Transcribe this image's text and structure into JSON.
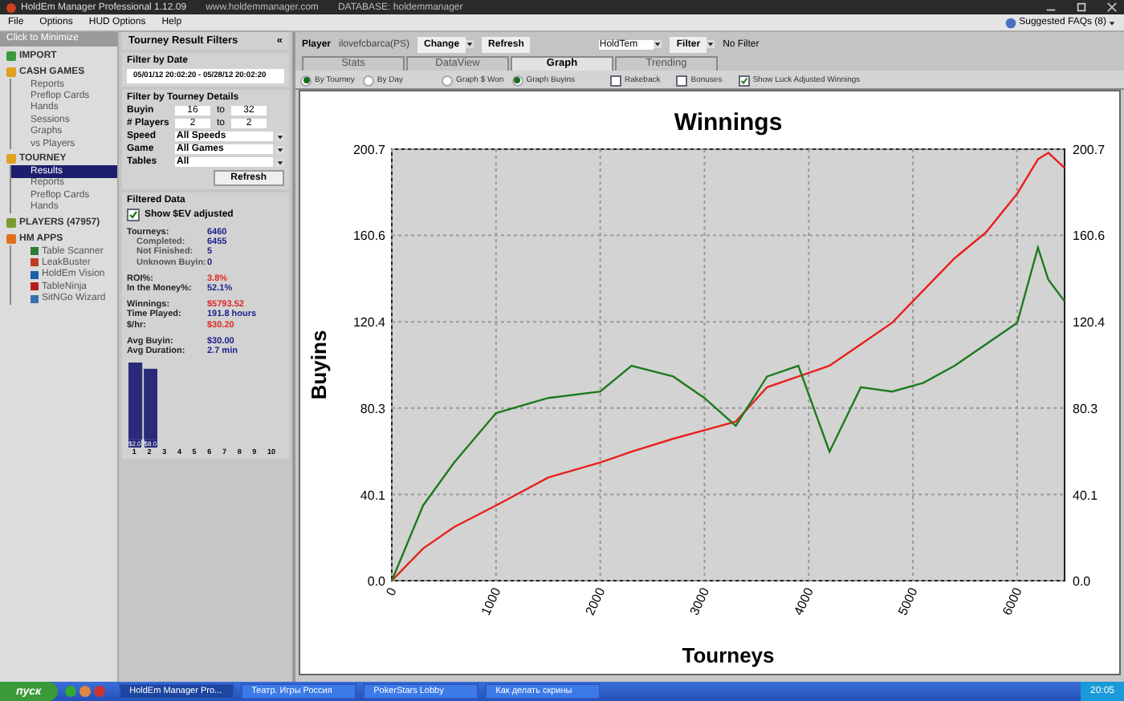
{
  "window": {
    "title": "HoldEm Manager Professional 1.12.09",
    "website": "www.holdemmanager.com",
    "database": "DATABASE: holdemmanager"
  },
  "menu": [
    "File",
    "Options",
    "HUD Options",
    "Help"
  ],
  "faq": "Suggested FAQs (8)",
  "nav": {
    "minimize": "Click to Minimize",
    "sections": [
      {
        "label": "IMPORT"
      },
      {
        "label": "CASH GAMES",
        "children": [
          {
            "label": "Reports",
            "selected": false
          },
          {
            "label": "Preflop Cards",
            "selected": false
          },
          {
            "label": "Hands",
            "selected": false
          },
          {
            "label": "Sessions",
            "selected": false
          },
          {
            "label": "Graphs",
            "selected": false
          },
          {
            "label": "vs Players",
            "selected": false
          }
        ]
      },
      {
        "label": "TOURNEY",
        "children": [
          {
            "label": "Results",
            "selected": true
          },
          {
            "label": "Reports",
            "selected": false
          },
          {
            "label": "Preflop Cards",
            "selected": false
          },
          {
            "label": "Hands",
            "selected": false
          }
        ]
      },
      {
        "label": "PLAYERS (47957)"
      },
      {
        "label": "HM APPS",
        "children": [
          {
            "label": "Table Scanner",
            "selected": false
          },
          {
            "label": "LeakBuster",
            "selected": false
          },
          {
            "label": "HoldEm Vision",
            "selected": false
          },
          {
            "label": "TableNinja",
            "selected": false
          },
          {
            "label": "SitNGo Wizard",
            "selected": false
          }
        ]
      }
    ]
  },
  "filters": {
    "title": "Tourney Result Filters",
    "collapse": "«",
    "date_heading": "Filter by Date",
    "date_range": "05/01/12 20:02:20 - 05/28/12 20:02:20",
    "details_heading": "Filter by Tourney Details",
    "rows": [
      {
        "kind": "range",
        "label": "Buyin",
        "from": "16",
        "sep": "to",
        "to": "32"
      },
      {
        "kind": "range",
        "label": "# Players",
        "from": "2",
        "sep": "to",
        "to": "2"
      },
      {
        "kind": "select",
        "label": "Speed",
        "value": "All Speeds"
      },
      {
        "kind": "select",
        "label": "Game",
        "value": "All Games"
      },
      {
        "kind": "select",
        "label": "Tables",
        "value": "All"
      }
    ],
    "refresh": "Refresh"
  },
  "filtered": {
    "heading": "Filtered Data",
    "ev_checkbox": {
      "label": "Show $EV adjusted",
      "checked": true
    },
    "groups": [
      [
        {
          "label": "Tourneys:",
          "value": "6460",
          "color": "#1c1c8c",
          "children": [
            {
              "label": "Completed:",
              "value": "6455",
              "color": "#1c1c8c"
            },
            {
              "label": "Not Finished:",
              "value": "5",
              "color": "#1c1c8c"
            },
            {
              "label": "Unknown Buyin:",
              "value": "0",
              "color": "#1c1c8c"
            }
          ]
        }
      ],
      [
        {
          "label": "ROI%:",
          "value": "3.8%",
          "color": "#e02828"
        },
        {
          "label": "In the Money%:",
          "value": "52.1%",
          "color": "#1c1c8c"
        }
      ],
      [
        {
          "label": "Winnings:",
          "value": "$5793.52",
          "color": "#e02828"
        },
        {
          "label": "Time Played:",
          "value": "191.8 hours",
          "color": "#1c1c8c"
        },
        {
          "label": "$/hr:",
          "value": "$30.20",
          "color": "#e02828"
        }
      ],
      [
        {
          "label": "Avg Buyin:",
          "value": "$30.00",
          "color": "#1c1c8c"
        },
        {
          "label": "Avg Duration:",
          "value": "2.7 min",
          "color": "#1c1c8c"
        }
      ]
    ],
    "histogram": {
      "bar_labels": [
        "$2.0",
        "$8.0"
      ],
      "axis_labels": [
        "1",
        "2",
        "3",
        "4",
        "5",
        "6",
        "7",
        "8",
        "9",
        "10"
      ]
    }
  },
  "player_bar": {
    "label": "Player",
    "name": "ilovefcbarca(PS)",
    "change": "Change",
    "refresh": "Refresh",
    "game": "HoldTem",
    "filter": "Filter",
    "filter_value": "No Filter"
  },
  "tabs": [
    {
      "label": "Stats",
      "selected": false
    },
    {
      "label": "DataView",
      "selected": false
    },
    {
      "label": "Graph",
      "selected": true
    },
    {
      "label": "Trending",
      "selected": false
    }
  ],
  "graph_options": {
    "radio_groups": [
      [
        {
          "label": "By Tourney",
          "selected": true
        },
        {
          "label": "By Day",
          "selected": false
        }
      ],
      [
        {
          "label": "Graph $ Won",
          "selected": false
        },
        {
          "label": "Graph Buyins",
          "selected": true
        }
      ]
    ],
    "checkboxes": [
      {
        "label": "Rakeback",
        "checked": false
      },
      {
        "label": "Bonuses",
        "checked": false
      },
      {
        "label": "Show Luck Adjusted Winnings",
        "checked": true
      }
    ]
  },
  "chart": {
    "chart_data": {
      "type": "line",
      "title": "Winnings",
      "xlabel": "Tourneys",
      "ylabel": "Buyins",
      "grid": true,
      "x": [
        0,
        300,
        600,
        1000,
        1500,
        2000,
        2300,
        2700,
        3000,
        3300,
        3600,
        3900,
        4200,
        4500,
        4800,
        5100,
        5400,
        5700,
        6000,
        6200,
        6300,
        6455
      ],
      "series": [
        {
          "color": "#e8201c",
          "values": [
            0,
            15,
            25,
            35,
            48,
            55,
            60,
            66,
            70,
            74,
            90,
            95,
            100,
            110,
            120,
            135,
            150,
            162,
            180,
            196,
            199,
            192
          ]
        },
        {
          "color": "#1e7a1e",
          "values": [
            0,
            35,
            55,
            78,
            85,
            88,
            100,
            95,
            85,
            72,
            95,
            100,
            60,
            90,
            88,
            92,
            100,
            110,
            120,
            155,
            140,
            130
          ]
        }
      ],
      "xlim": [
        0,
        6455
      ],
      "ylim": [
        0,
        200.7
      ],
      "xticks": [
        0,
        1000,
        2000,
        3000,
        4000,
        5000,
        6000
      ],
      "yticks": [
        {
          "value": 0,
          "label": "0.0"
        },
        {
          "value": 40.1,
          "label": "40.1"
        },
        {
          "value": 80.3,
          "label": "80.3"
        },
        {
          "value": 120.4,
          "label": "120.4"
        },
        {
          "value": 160.6,
          "label": "160.6"
        },
        {
          "value": 200.7,
          "label": "200.7"
        }
      ]
    }
  },
  "taskbar": {
    "start": "пуск",
    "tasks": [
      {
        "label": "HoldEm Manager Pro...",
        "selected": true
      },
      {
        "label": "Театр. Игры Россия",
        "selected": false
      },
      {
        "label": "PokerStars Lobby",
        "selected": false
      },
      {
        "label": "Как делать скрины",
        "selected": false
      }
    ],
    "clock": "20:05"
  }
}
